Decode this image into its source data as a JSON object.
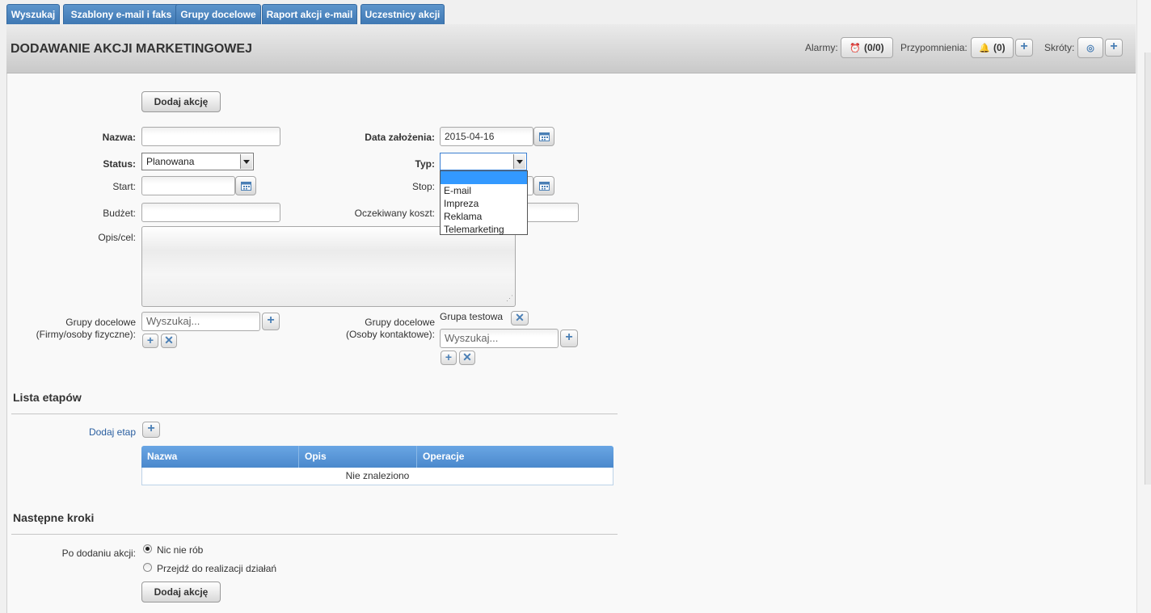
{
  "tabs": [
    "Wyszukaj",
    "Szablony e-mail i faks",
    "Grupy docelowe",
    "Raport akcji e-mail",
    "Uczestnicy akcji"
  ],
  "header": {
    "title": "DODAWANIE AKCJI MARKETINGOWEJ",
    "alarms_label": "Alarmy:",
    "alarms_count": "(0/0)",
    "reminders_label": "Przypomnienia:",
    "reminders_count": "(0)",
    "shortcuts_label": "Skróty:"
  },
  "form": {
    "add_button": "Dodaj akcję",
    "name_label": "Nazwa:",
    "name_value": "",
    "created_label": "Data założenia:",
    "created_value": "2015-04-16",
    "status_label": "Status:",
    "status_value": "Planowana",
    "type_label": "Typ:",
    "type_value": "",
    "type_options": [
      "",
      "E-mail",
      "Impreza",
      "Reklama",
      "Telemarketing"
    ],
    "start_label": "Start:",
    "stop_label": "Stop:",
    "budget_label": "Budżet:",
    "expected_cost_label": "Oczekiwany koszt:",
    "description_label": "Opis/cel:",
    "target_companies_label_1": "Grupy docelowe",
    "target_companies_label_2": "(Firmy/osoby fizyczne):",
    "target_companies_search": "Wyszukaj...",
    "target_contacts_label_1": "Grupy docelowe",
    "target_contacts_label_2": "(Osoby kontaktowe):",
    "target_contacts_selected": "Grupa testowa",
    "target_contacts_search": "Wyszukaj..."
  },
  "stages": {
    "title": "Lista etapów",
    "add_link": "Dodaj etap",
    "columns": [
      "Nazwa",
      "Opis",
      "Operacje"
    ],
    "empty_text": "Nie znaleziono"
  },
  "next_steps": {
    "title": "Następne kroki",
    "after_label": "Po dodaniu akcji:",
    "option_1": "Nic nie rób",
    "option_2": "Przejdź do realizacji działań",
    "selected": "Nic nie rób",
    "add_button": "Dodaj akcję"
  }
}
